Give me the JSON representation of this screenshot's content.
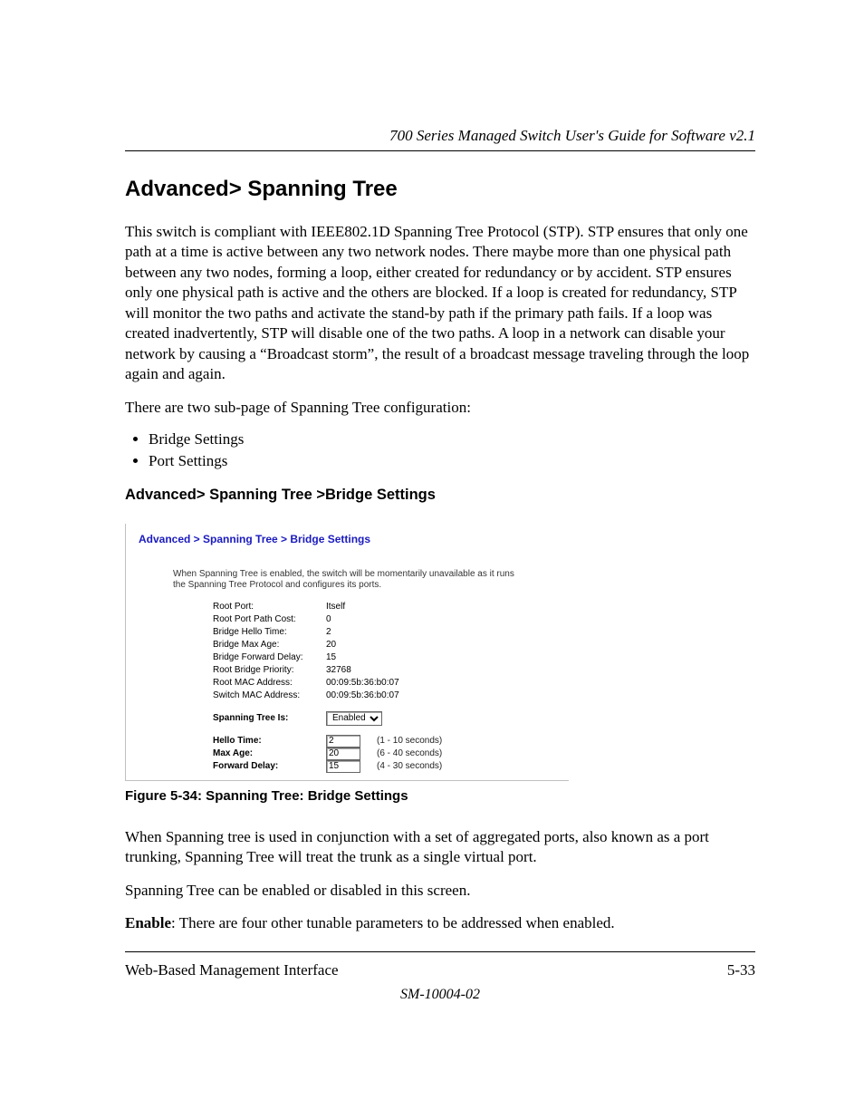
{
  "header": {
    "running_head": "700 Series Managed Switch User's Guide for Software v2.1"
  },
  "section": {
    "title": "Advanced> Spanning Tree",
    "para1": "This switch is compliant with IEEE802.1D Spanning Tree Protocol (STP).  STP ensures that only one path at a time is active between any two network nodes. There maybe more than one physical path between any two nodes, forming a loop, either created for redundancy or by accident.  STP ensures only one physical path is active and the others are blocked. If a loop is created for redundancy, STP will monitor the two paths and activate the stand-by path if the primary path fails.  If a loop was created inadvertently, STP will disable one of the two paths.  A loop in a network can disable your network by causing a “Broadcast storm”, the result of a broadcast message traveling through the loop again and again.",
    "para2": "There are two sub-page of Spanning Tree configuration:",
    "bullets": [
      "Bridge Settings",
      "Port Settings"
    ]
  },
  "subsection": {
    "title": "Advanced> Spanning Tree >Bridge Settings"
  },
  "figure": {
    "breadcrumb": "Advanced > Spanning Tree > Bridge Settings",
    "note": "When Spanning Tree is enabled, the switch will be momentarily unavailable as it runs the Spanning Tree Protocol and configures its ports.",
    "static_rows": [
      {
        "label": "Root Port:",
        "value": "Itself"
      },
      {
        "label": "Root Port Path Cost:",
        "value": "0"
      },
      {
        "label": "Bridge Hello Time:",
        "value": "2"
      },
      {
        "label": "Bridge Max Age:",
        "value": "20"
      },
      {
        "label": "Bridge Forward Delay:",
        "value": "15"
      },
      {
        "label": "Root Bridge Priority:",
        "value": "32768"
      },
      {
        "label": "Root MAC Address:",
        "value": "00:09:5b:36:b0:07"
      },
      {
        "label": "Switch MAC Address:",
        "value": "00:09:5b:36:b0:07"
      }
    ],
    "edit_rows": {
      "spanning_tree": {
        "label": "Spanning Tree Is:",
        "value": "Enabled"
      },
      "hello": {
        "label": "Hello Time:",
        "value": "2",
        "hint": "(1 - 10 seconds)"
      },
      "max_age": {
        "label": "Max Age:",
        "value": "20",
        "hint": "(6 - 40 seconds)"
      },
      "fwd": {
        "label": "Forward Delay:",
        "value": "15",
        "hint": "(4 - 30 seconds)"
      }
    },
    "caption": "Figure 5-34:  Spanning Tree: Bridge Settings"
  },
  "after_figure": {
    "para1": "When Spanning tree is used in conjunction with a set of aggregated ports, also known as a port trunking, Spanning Tree will treat the trunk as a single virtual port.",
    "para2": "Spanning Tree can be enabled or disabled in this screen.",
    "enable_lead": "Enable",
    "enable_rest": ": There are four other tunable parameters to be addressed when enabled."
  },
  "footer": {
    "left": "Web-Based Management Interface",
    "right": "5-33",
    "doc_id": "SM-10004-02"
  }
}
